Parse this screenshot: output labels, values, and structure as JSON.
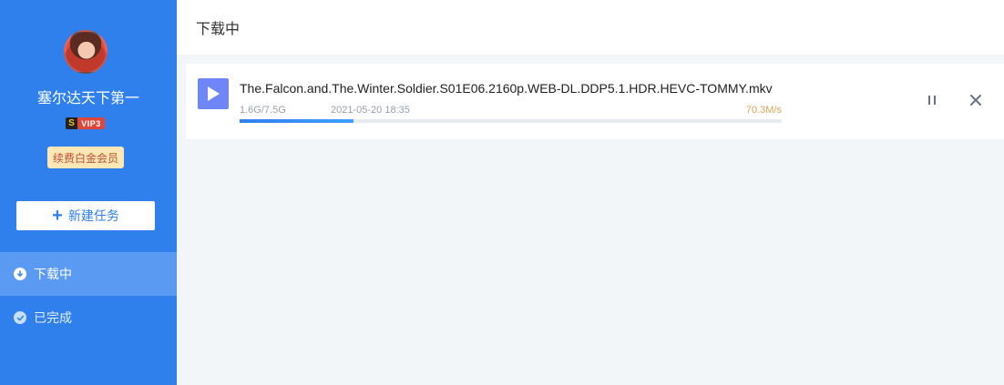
{
  "sidebar": {
    "username": "塞尔达天下第一",
    "vip_badge": {
      "s": "S",
      "label": "VIP3"
    },
    "renew_label": "续费白金会员",
    "new_task_label": "新建任务",
    "nav": [
      {
        "label": "下载中",
        "icon": "download-icon",
        "active": true
      },
      {
        "label": "已完成",
        "icon": "check-icon",
        "active": false
      }
    ]
  },
  "header": {
    "title": "下载中"
  },
  "task": {
    "file_name": "The.Falcon.and.The.Winter.Soldier.S01E06.2160p.WEB-DL.DDP5.1.HDR.HEVC-TOMMY.mkv",
    "size_progress": "1.6G/7.5G",
    "date": "2021-05-20 18:35",
    "speed": "70.3M/s",
    "progress_fraction": 0.21
  },
  "colors": {
    "sidebar_bg": "#2f80ed",
    "active_nav": "#5b9af3",
    "accent": "#2f80ed",
    "speed": "#d8a55a",
    "file_icon": "#6f86f8"
  }
}
